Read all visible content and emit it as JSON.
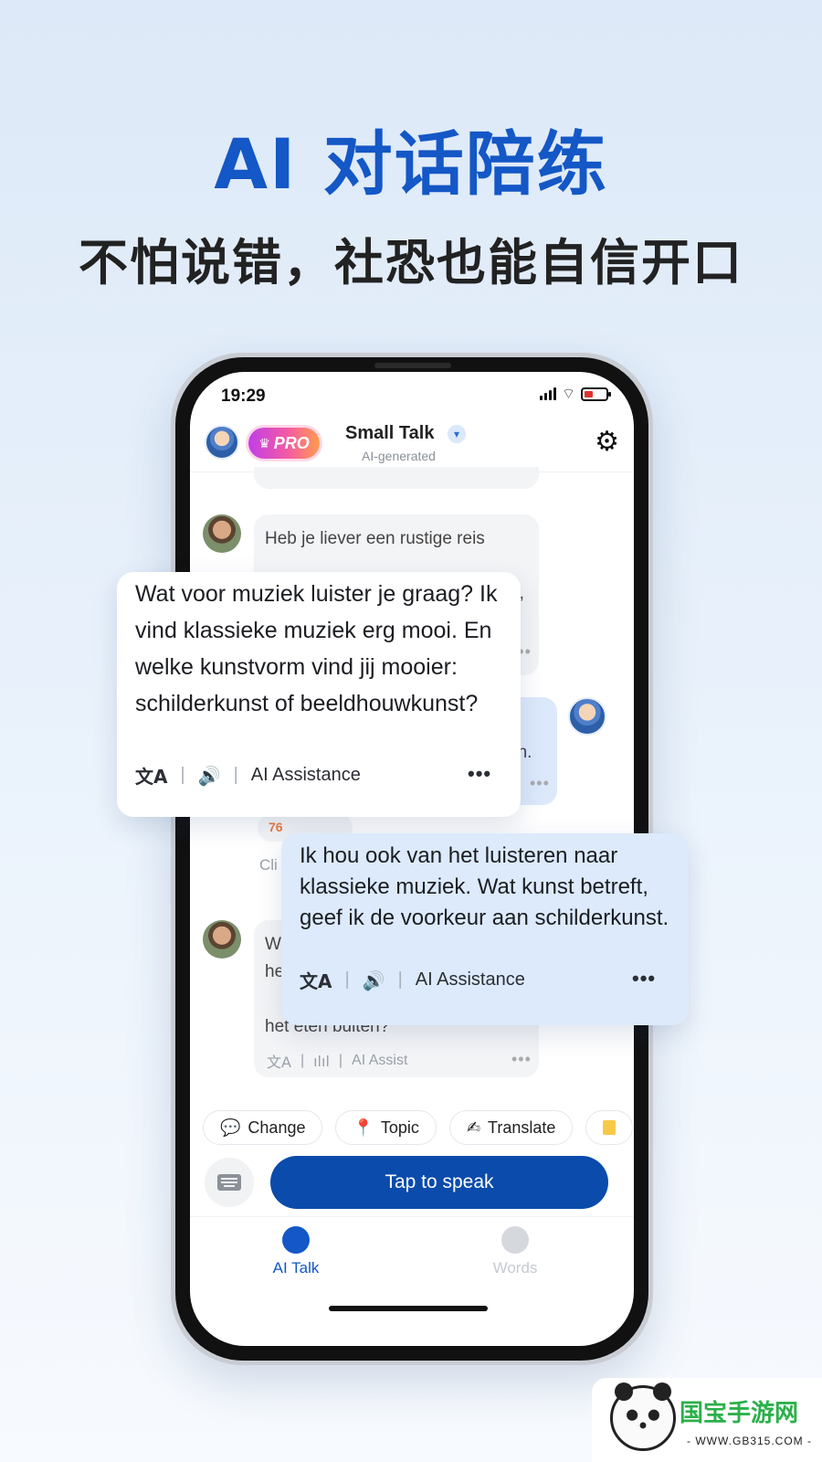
{
  "hero": {
    "title": "AI 对话陪练",
    "subtitle": "不怕说错，社恐也能自信开口"
  },
  "status_bar": {
    "time": "19:29"
  },
  "chat_header": {
    "pro_label": "PRO",
    "title": "Small Talk",
    "subtitle": "AI-generated"
  },
  "messages": {
    "ai_msg_1_visible": "Heb je liever een rustige reis",
    "ai_msg_1_partial_end": "e,",
    "user_msg_partial": "en.",
    "score_partial": "76",
    "hint_partial": "Cli",
    "ai_msg_2_partial_start": "W",
    "ai_msg_2_partial_he": "he",
    "ai_msg_2_line": "het eten buiten?",
    "ai_msg_2_actions_label": "AI Assist"
  },
  "card_ai": {
    "text": "Wat voor muziek luister je graag? Ik vind klassieke muziek erg mooi. En welke kunstvorm vind jij mooier: schilderkunst of beeldhouwkunst?",
    "assist_label": "AI Assistance"
  },
  "card_user": {
    "text": "Ik hou ook van het luisteren naar klassieke muziek. Wat kunst betreft, geef ik de voorkeur aan schilderkunst.",
    "assist_label": "AI Assistance"
  },
  "chips": [
    {
      "icon": "💬",
      "label": "Change"
    },
    {
      "icon": "📍",
      "label": "Topic"
    },
    {
      "icon": "✍",
      "label": "Translate"
    }
  ],
  "speak_button": "Tap to speak",
  "tabs": {
    "ai_talk": "AI Talk",
    "words": "Words"
  },
  "watermark": {
    "title": "国宝手游网",
    "url": "- WWW.GB315.COM -"
  },
  "colors": {
    "brand_blue": "#1457c6",
    "speak_blue": "#0a4bab",
    "watermark_green": "#2bb04a"
  }
}
